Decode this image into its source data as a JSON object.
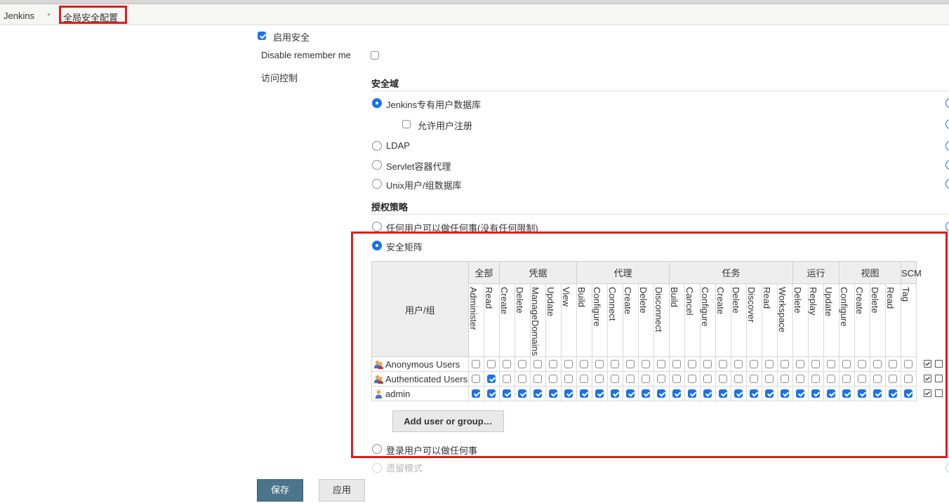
{
  "breadcrumb": {
    "home": "Jenkins",
    "separator": "▸",
    "current": "全局安全配置"
  },
  "security": {
    "enable_label": "启用安全",
    "enable_checked": true,
    "disable_remember_label": "Disable remember me",
    "disable_remember_checked": false,
    "access_control_label": "访问控制"
  },
  "realm": {
    "title": "安全域",
    "options": [
      {
        "label": "Jenkins专有用户数据库",
        "selected": true
      },
      {
        "label": "LDAP",
        "selected": false
      },
      {
        "label": "Servlet容器代理",
        "selected": false
      },
      {
        "label": "Unix用户/组数据库",
        "selected": false
      }
    ],
    "allow_signup_label": "允许用户注册",
    "allow_signup_checked": false
  },
  "authorization": {
    "title": "授权策略",
    "options": [
      {
        "label": "任何用户可以做任何事(没有任何限制)",
        "selected": false
      },
      {
        "label": "安全矩阵",
        "selected": true
      },
      {
        "label": "登录用户可以做任何事",
        "selected": false
      },
      {
        "label": "遗留模式",
        "selected": false
      }
    ]
  },
  "matrix": {
    "user_group_header": "用户/组",
    "groups": [
      {
        "label": "全部",
        "span": 2
      },
      {
        "label": "凭据",
        "span": 5
      },
      {
        "label": "代理",
        "span": 6
      },
      {
        "label": "任务",
        "span": 8
      },
      {
        "label": "运行",
        "span": 3
      },
      {
        "label": "视图",
        "span": 4
      },
      {
        "label": "SCM",
        "span": 1
      }
    ],
    "permissions": [
      "Administer",
      "Read",
      "Create",
      "Delete",
      "ManageDomains",
      "Update",
      "View",
      "Build",
      "Configure",
      "Connect",
      "Create",
      "Delete",
      "Disconnect",
      "Build",
      "Cancel",
      "Configure",
      "Create",
      "Delete",
      "Discover",
      "Read",
      "Workspace",
      "Delete",
      "Replay",
      "Update",
      "Configure",
      "Create",
      "Delete",
      "Read",
      "Tag"
    ],
    "rows": [
      {
        "name": "Anonymous Users",
        "icon": "group-icon",
        "checked": [
          false,
          false,
          false,
          false,
          false,
          false,
          false,
          false,
          false,
          false,
          false,
          false,
          false,
          false,
          false,
          false,
          false,
          false,
          false,
          false,
          false,
          false,
          false,
          false,
          false,
          false,
          false,
          false,
          false
        ]
      },
      {
        "name": "Authenticated Users",
        "icon": "group-icon",
        "checked": [
          false,
          true,
          false,
          false,
          false,
          false,
          false,
          false,
          false,
          false,
          false,
          false,
          false,
          false,
          false,
          false,
          false,
          false,
          false,
          false,
          false,
          false,
          false,
          false,
          false,
          false,
          false,
          false,
          false
        ]
      },
      {
        "name": "admin",
        "icon": "user-icon",
        "checked": [
          true,
          true,
          true,
          true,
          true,
          true,
          true,
          true,
          true,
          true,
          true,
          true,
          true,
          true,
          true,
          true,
          true,
          true,
          true,
          true,
          true,
          true,
          true,
          true,
          true,
          true,
          true,
          true,
          true
        ]
      }
    ],
    "add_button": "Add user or group…"
  },
  "buttons": {
    "save": "保存",
    "apply": "应用"
  },
  "colors": {
    "accent": "#1a73e8",
    "highlight_box": "#e21b1b",
    "save_button": "#4b758b"
  }
}
